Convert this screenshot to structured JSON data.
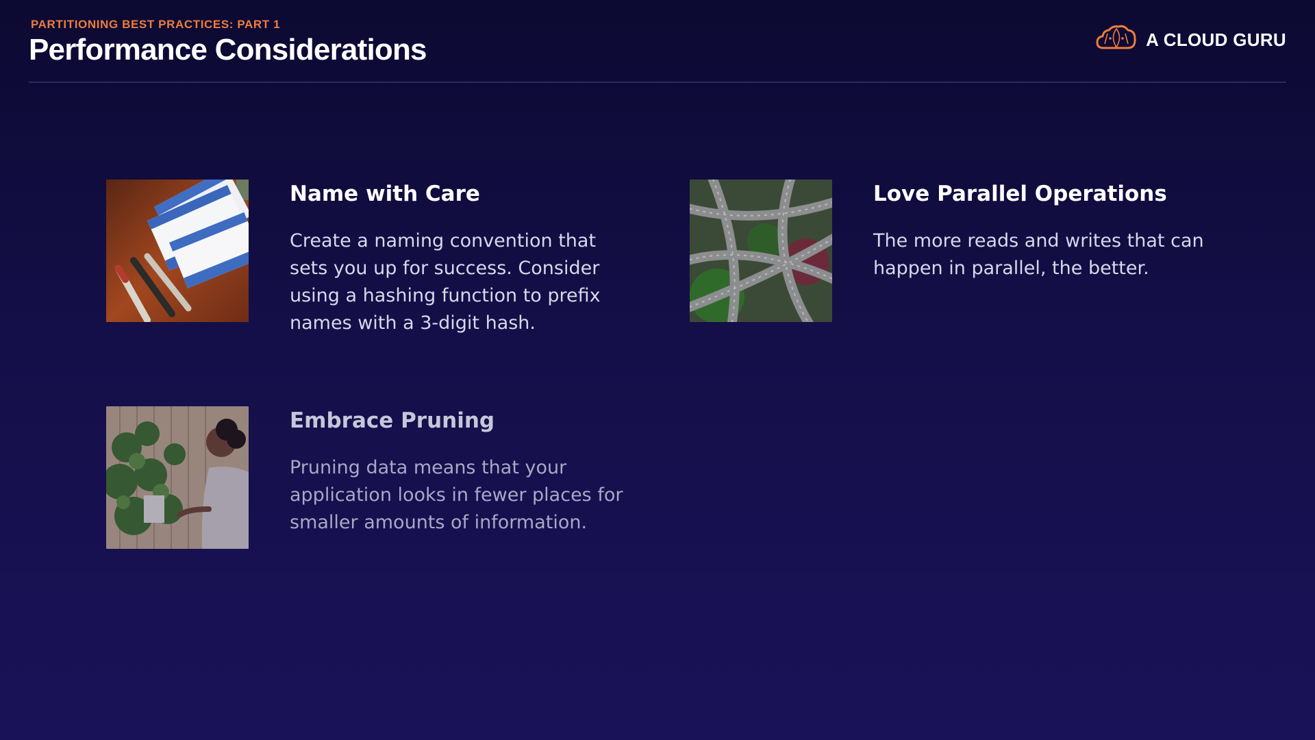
{
  "header": {
    "eyebrow": "PARTITIONING BEST PRACTICES: PART 1",
    "title": "Performance Considerations"
  },
  "brand": {
    "name": "A CLOUD GURU",
    "icon": "cloud-logo-icon",
    "accent_color": "#f07c3a"
  },
  "cards": [
    {
      "title": "Name with Care",
      "text": "Create a naming convention that sets you up for success. Consider using a hashing function to prefix names with a 3-digit hash.",
      "image": "name-tags-image"
    },
    {
      "title": "Love Parallel Operations",
      "text": "The more reads and writes that can happen in parallel, the better.",
      "image": "highway-interchange-image"
    },
    {
      "title": "Embrace Pruning",
      "text": "Pruning data means that your application looks in fewer places for smaller amounts of information.",
      "image": "pruning-plants-image"
    }
  ],
  "colors": {
    "background_top": "#0c0932",
    "background_bottom": "#1a1258",
    "eyebrow": "#f07c3a"
  }
}
